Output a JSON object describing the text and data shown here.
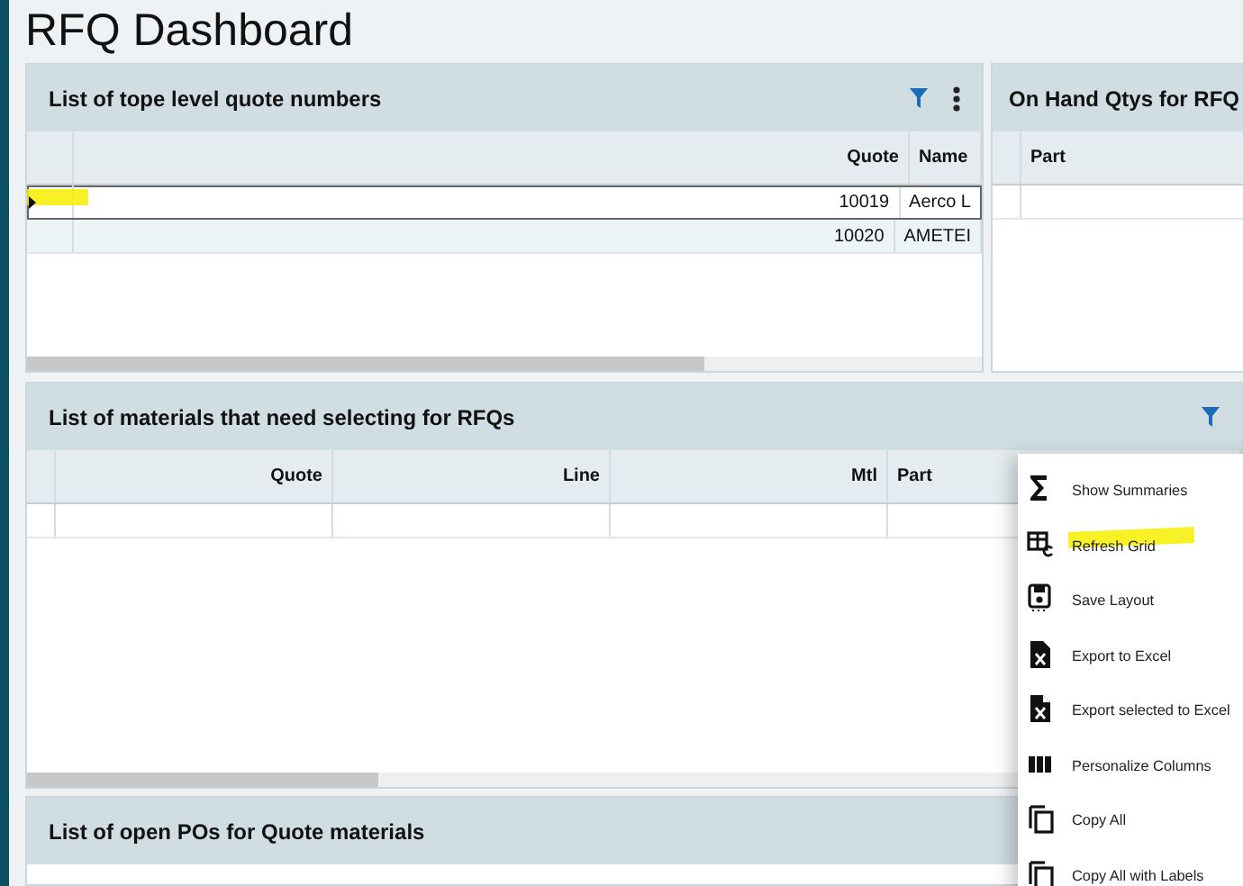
{
  "title": "RFQ Dashboard",
  "panels": [
    {
      "title": "List of tope level quote numbers",
      "filter": true,
      "more": true,
      "scrollbar": true,
      "columns": [
        {
          "label": "Quote"
        },
        {
          "label": "Name"
        }
      ],
      "rows": [
        {
          "cells": [
            "10019",
            "Aerco L"
          ],
          "selected": true,
          "highlighted": true
        },
        {
          "cells": [
            "10020",
            "AMETEI"
          ],
          "selected": false,
          "highlighted": false
        }
      ]
    },
    {
      "title": "On Hand Qtys for RFQ",
      "filter": false,
      "more": false,
      "scrollbar": false,
      "columns": [
        {
          "label": "Part"
        }
      ]
    },
    {
      "title": "List of materials that need selecting for RFQs",
      "filter": true,
      "more": false,
      "scrollbar": true,
      "columns": [
        {
          "label": "Quote"
        },
        {
          "label": "Line"
        },
        {
          "label": "Mtl"
        },
        {
          "label": "Part"
        }
      ]
    },
    {
      "title": "List of open POs for Quote materials",
      "filter": false,
      "more": false,
      "scrollbar": false
    }
  ],
  "menu": [
    {
      "label": "Show Summaries",
      "highlighted": false
    },
    {
      "label": "Refresh Grid",
      "highlighted": true
    },
    {
      "label": "Save Layout",
      "highlighted": false
    },
    {
      "label": "Export to Excel",
      "highlighted": false
    },
    {
      "label": "Export selected to Excel",
      "highlighted": false
    },
    {
      "label": "Personalize Columns",
      "highlighted": false
    },
    {
      "label": "Copy All",
      "highlighted": false
    },
    {
      "label": "Copy All with Labels",
      "highlighted": false
    }
  ]
}
